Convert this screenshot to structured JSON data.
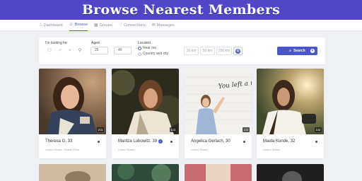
{
  "banner": {
    "title": "Browse Nearest Members"
  },
  "nav": {
    "items": [
      {
        "label": "Dashboard",
        "icon": "home-icon"
      },
      {
        "label": "Browse",
        "icon": "user-icon",
        "active": true
      },
      {
        "label": "Groups",
        "icon": "groups-icon"
      },
      {
        "label": "Connections",
        "icon": "heart-icon"
      },
      {
        "label": "Messages",
        "icon": "mail-icon"
      }
    ]
  },
  "filter": {
    "looking_for_label": "I'm looking for",
    "gender_icons": [
      "couple-icon",
      "male-icon",
      "female-icon",
      "other-gender-icon"
    ],
    "aged_label": "Aged",
    "age_from": "25",
    "age_to": "40",
    "located_label": "Located",
    "location_options": [
      "Near me",
      "Country and city"
    ],
    "location_selected": "Near me",
    "distances": [
      "10 km",
      "50 km",
      "250 km"
    ],
    "search_label": "Search",
    "accent_color": "#4a56c9"
  },
  "members": [
    {
      "name": "Theresa G, 33",
      "location": "United States, Middle River",
      "photos": "2",
      "verified": false
    },
    {
      "name": "Maritza Lubowitz, 39",
      "location": "United States",
      "photos": "1",
      "verified": true
    },
    {
      "name": "Angelica Gerlach, 30",
      "location": "United States",
      "photos": "1",
      "verified": false
    },
    {
      "name": "Maida Kunde, 32",
      "location": "United States",
      "photos": "1",
      "verified": false
    }
  ],
  "wall_text": "You left a mark"
}
